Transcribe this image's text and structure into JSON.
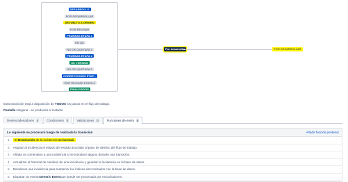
{
  "diagram": {
    "statuses": [
      {
        "label": "DESARROLLO",
        "color": "blue"
      },
      {
        "label": "POR DESARROLLAR",
        "color": "gray"
      },
      {
        "label": "DEVUELTO A ORIGEN",
        "color": "yellow"
      },
      {
        "label": "POR REVISAR",
        "color": "gray"
      },
      {
        "label": "PRUEBAS ETAPA 1",
        "color": "blue"
      },
      {
        "label": "EN QA",
        "color": "gray"
      },
      {
        "label": "NO OK QA ETAPA 1",
        "color": "gray"
      },
      {
        "label": "PRUEBAS ETAPA 2",
        "color": "blue"
      },
      {
        "label": "OK VERSIÓN",
        "color": "green"
      },
      {
        "label": "NO OK QA ETAPA 2",
        "color": "gray"
      },
      {
        "label": "CORRECCIONES ETAP...",
        "color": "blue"
      },
      {
        "label": "POR REVISAR ETAPA 2",
        "color": "gray"
      },
      {
        "label": "FINALIZADOS",
        "color": "green"
      }
    ],
    "transition_label": "Por desarrollar",
    "target_status": "POR DESARROLLAR"
  },
  "description": {
    "prefix": "Esta transición está a disposición de ",
    "bold": "TODOS",
    "suffix": " los pasos en el flujo de trabajo."
  },
  "screen": {
    "label": "Pantalla",
    "value": " Ninguna - se producirá al instante"
  },
  "tabs": [
    {
      "label": "Desencadenadores",
      "count": "0"
    },
    {
      "label": "Condiciones",
      "count": "0"
    },
    {
      "label": "Validaciones",
      "count": "0"
    },
    {
      "label": "Funciones de envío",
      "count": "6"
    }
  ],
  "panel": {
    "title": "Lo siguiente se procesará luego de realizada la transición",
    "add_link": "Añadir función posterior",
    "rules": [
      {
        "num": "1.",
        "pre": "El ",
        "bold": "Resolución",
        "mid": " de la incidencia ",
        "bold2": "se borrará",
        "post": "."
      },
      {
        "num": "2.",
        "text": "Asignar al incidencia el estado del estado asociado al paso de destino del flujo de trabajo."
      },
      {
        "num": "3.",
        "text": "Añada un comentario a una incidencia si se introduce alguno durante una transición."
      },
      {
        "num": "4.",
        "text": "Actualizar el historial de cambios de una incidencia y guardar la incidencia en la base de datos."
      },
      {
        "num": "5.",
        "text": "Reindexar una incidencia para mantener los índices sincronizados con la base de datos."
      },
      {
        "num": "6.",
        "pre": "Disparar un evento ",
        "bold": "Generic Event",
        "post": " que puede ser procesado por escuchadores."
      }
    ]
  }
}
